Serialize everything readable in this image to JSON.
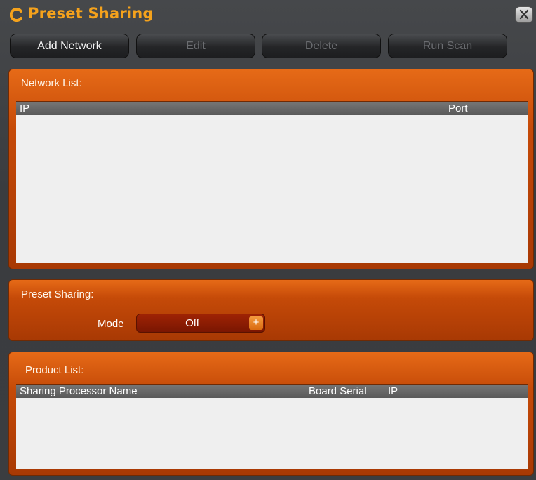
{
  "window": {
    "title": "Preset Sharing"
  },
  "toolbar": {
    "add_network": "Add Network",
    "edit": "Edit",
    "delete": "Delete",
    "run_scan": "Run Scan"
  },
  "network_list": {
    "title": "Network List:",
    "columns": [
      "IP",
      "Port"
    ],
    "rows": []
  },
  "preset_sharing": {
    "title": "Preset Sharing:",
    "mode_label": "Mode",
    "mode_value": "Off",
    "mode_plus": "+"
  },
  "product_list": {
    "title": "Product List:",
    "columns": [
      "Sharing Processor Name",
      "Board Serial",
      "IP"
    ],
    "rows": []
  },
  "colors": {
    "accent": "#f5a21c",
    "panel": "#c54a08",
    "grid_bg": "#efefef",
    "header": "#5a5a5a"
  },
  "icons": {
    "logo": "c-logo-icon",
    "close": "close-icon"
  }
}
